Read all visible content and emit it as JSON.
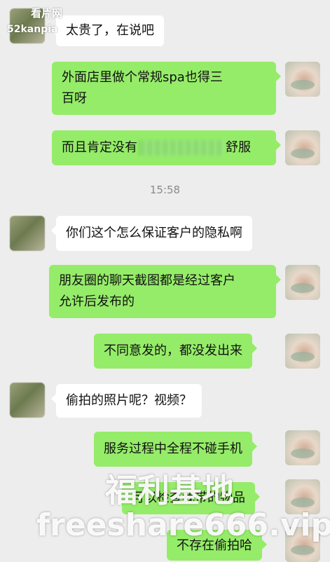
{
  "watermark": {
    "corner_title": "看片网",
    "corner_url": "52kanpia",
    "big_cn": "福利基地",
    "big_url": "freeshare666.vip"
  },
  "timestamp": "15:58",
  "messages": [
    {
      "side": "left",
      "text": "太贵了，在说吧"
    },
    {
      "side": "right",
      "line1": "外面店里做个常规spa也得三",
      "line2": "百呀"
    },
    {
      "side": "right",
      "text_before": "而且肯定没有",
      "text_after": "舒服"
    },
    {
      "side": "left",
      "text": "你们这个怎么保证客户的隐私啊"
    },
    {
      "side": "right",
      "line1": "朋友圈的聊天截图都是经过客户",
      "line2": "允许后发布的"
    },
    {
      "side": "right",
      "text": "不同意发的，都没发出来"
    },
    {
      "side": "left",
      "text": "偷拍的照片呢？视频？"
    },
    {
      "side": "right",
      "text": "服务过程中全程不碰手机"
    },
    {
      "side": "right",
      "text": "可以检查我带的物品"
    },
    {
      "side": "right",
      "text": "不存在偷拍哈"
    }
  ]
}
